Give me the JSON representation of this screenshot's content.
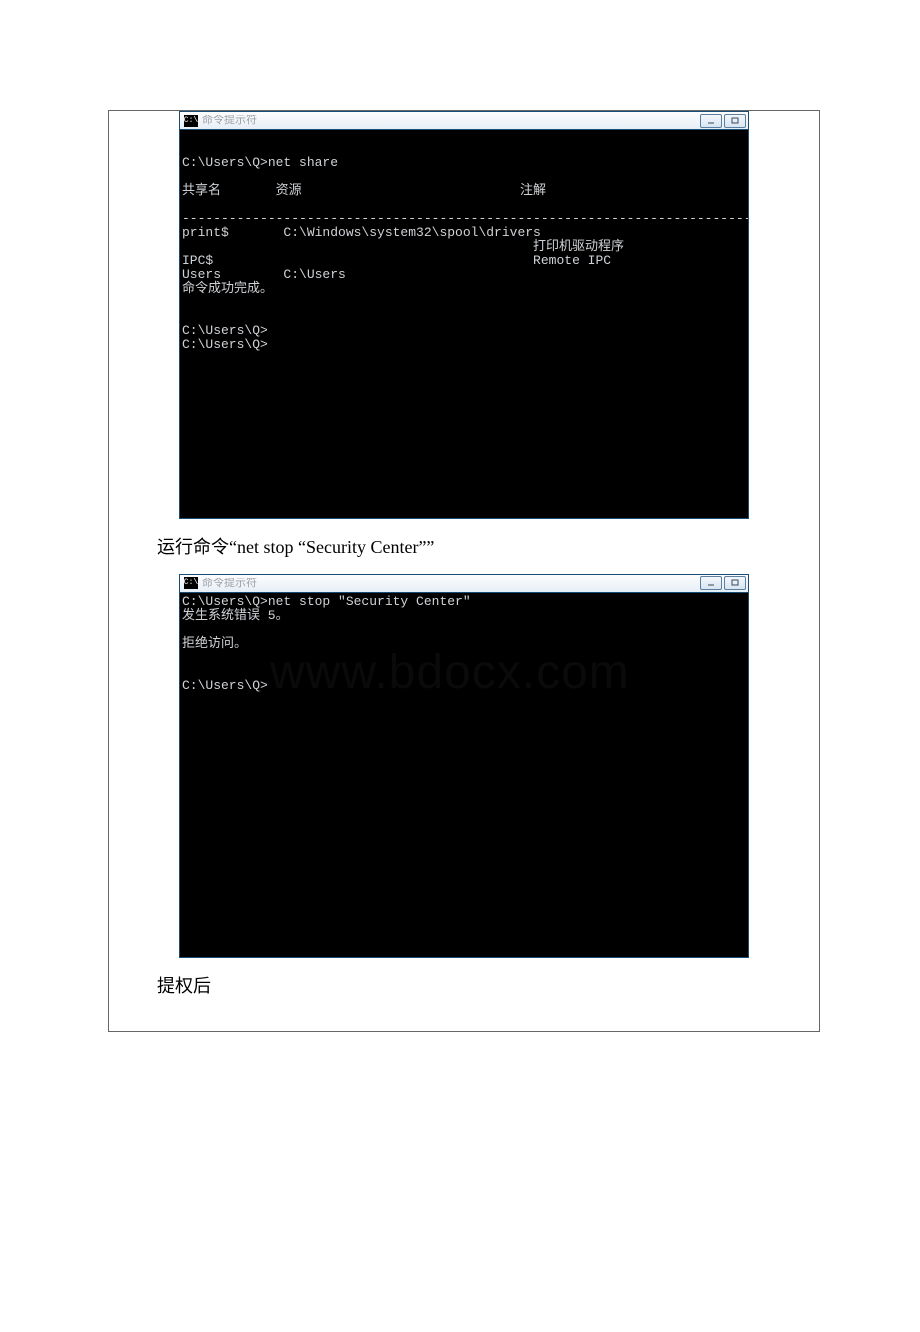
{
  "watermark": "www.bdocx.com",
  "window1": {
    "title_icon": "C:\\",
    "title": "命令提示符",
    "body": "C:\\Users\\Q>net share\n\n共享名       资源                            注解\n\n-------------------------------------------------------------------------------\nprint$       C:\\Windows\\system32\\spool\\drivers\n                                             打印机驱动程序\nIPC$                                         Remote IPC\nUsers        C:\\Users\n命令成功完成。\n\n\nC:\\Users\\Q>\nC:\\Users\\Q>"
  },
  "caption1": "运行命令“net stop “Security Center””",
  "window2": {
    "title_icon": "C:\\",
    "title": "命令提示符",
    "body": "C:\\Users\\Q>net stop \"Security Center\"\n发生系统错误 5。\n\n拒绝访问。\n\n\nC:\\Users\\Q>"
  },
  "caption2": "提权后"
}
